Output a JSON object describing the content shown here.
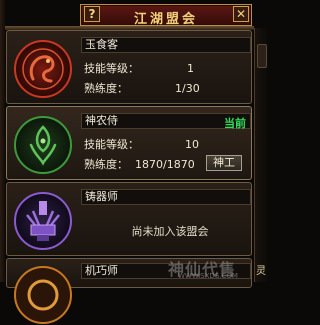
{
  "window": {
    "title": "江湖盟会",
    "help_label": "?",
    "close_label": "✕"
  },
  "guilds": [
    {
      "name": "玉食客",
      "skill_level_label": "技能等级：",
      "skill_level_value": "1",
      "proficiency_label": "熟练度：",
      "proficiency_value": "1/30"
    },
    {
      "name": "神农侍",
      "status": "当前",
      "skill_level_label": "技能等级：",
      "skill_level_value": "10",
      "proficiency_label": "熟练度：",
      "proficiency_value": "1870/1870",
      "action_label": "神工"
    },
    {
      "name": "铸器师",
      "notice": "尚未加入该盟会"
    },
    {
      "name": "机巧师"
    }
  ],
  "watermark": {
    "text": "神仙代售",
    "url": "WWW.SXDS.COM"
  },
  "right_edge_label": "灵",
  "colors": {
    "title_gold": "#f2d27a",
    "current_green": "#2fe05a",
    "emblem_red": "#c8391f",
    "emblem_green": "#3d9a3a",
    "emblem_purple": "#8a5ad0"
  }
}
